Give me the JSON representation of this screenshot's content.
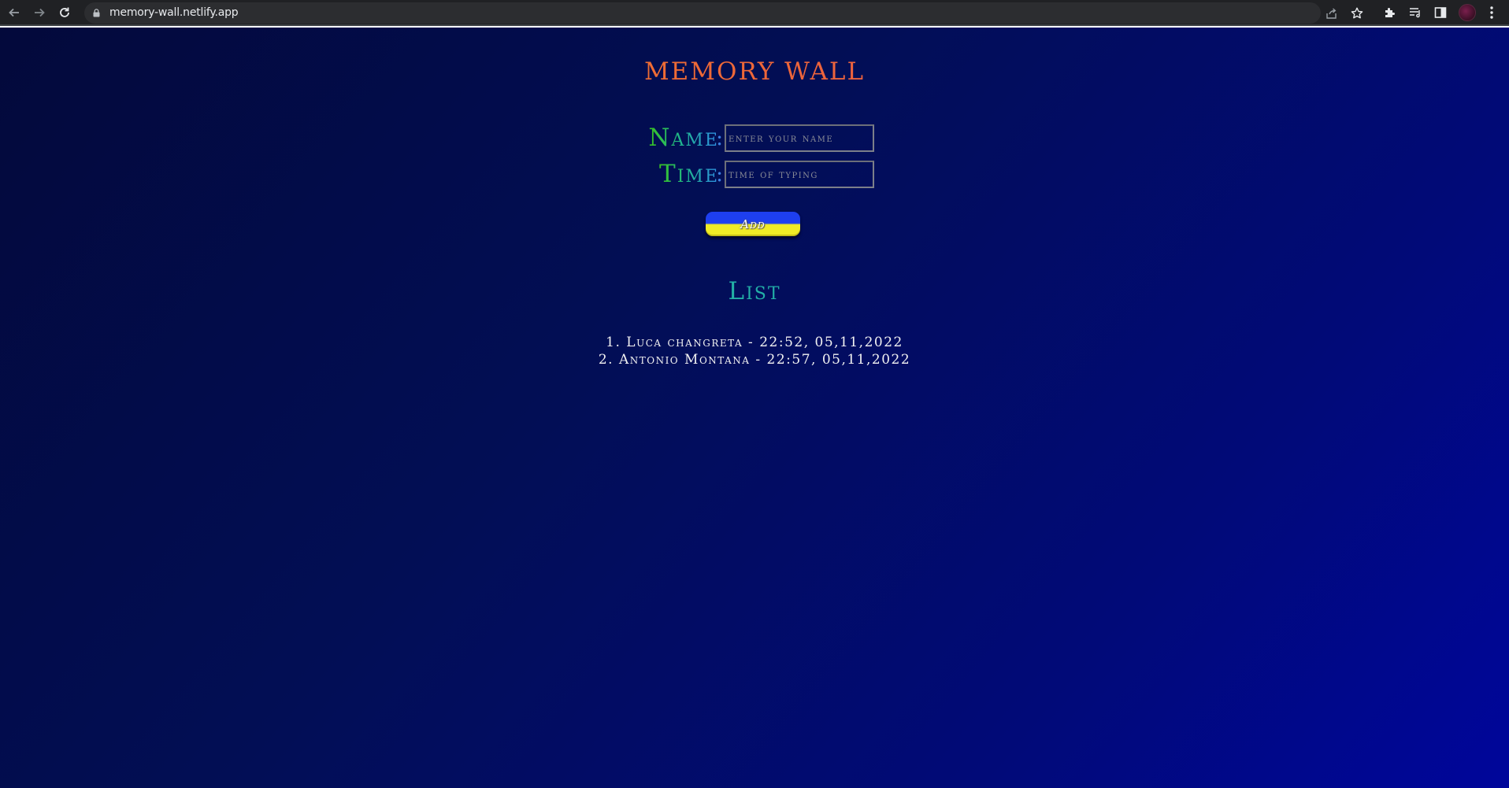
{
  "browser": {
    "url": "memory-wall.netlify.app",
    "icons": {
      "back": "back-arrow-icon",
      "forward": "forward-arrow-icon",
      "reload": "reload-icon",
      "lock": "lock-icon",
      "share": "share-icon",
      "bookmark": "star-icon",
      "extensions": "puzzle-icon",
      "reading_list": "queue-icon",
      "side_panel": "side-panel-icon",
      "menu": "kebab-menu-icon"
    }
  },
  "page": {
    "title": "MEMORY WALL",
    "form": {
      "name_label": "Name",
      "time_label": "Time",
      "colon": ":",
      "name_placeholder": "enter your name",
      "time_placeholder": "time of typing",
      "add_label": "Add"
    },
    "list_heading": "List",
    "entries": [
      {
        "index": "1.",
        "text": "Luca changreta - 22:52, 05,11,2022"
      },
      {
        "index": "2.",
        "text": "Antonio Montana - 22:57, 05,11,2022"
      }
    ]
  },
  "colors": {
    "title_gradient": [
      "#f3a51a",
      "#e8475e"
    ],
    "label_gradient": [
      "#39c21e",
      "#2f8fe8"
    ],
    "background": [
      "#03093b",
      "#00069b"
    ],
    "button_top": "#1e3ff0",
    "button_bottom": "#f0ec26"
  }
}
